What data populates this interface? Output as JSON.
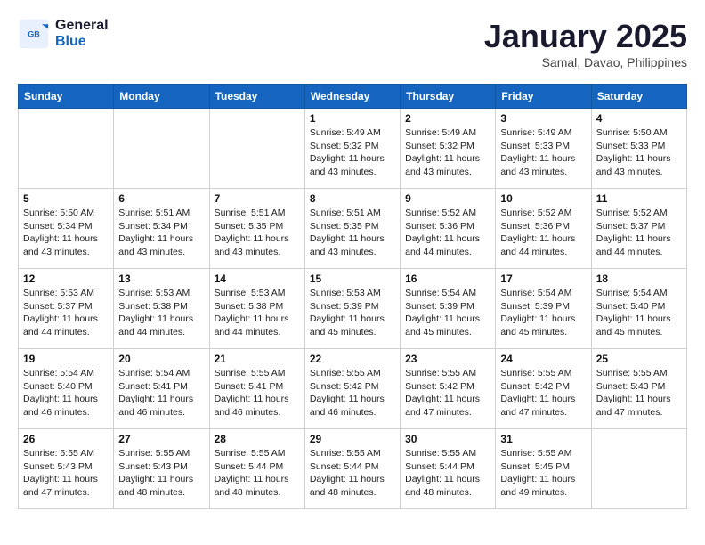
{
  "header": {
    "logo_line1": "General",
    "logo_line2": "Blue",
    "month": "January 2025",
    "location": "Samal, Davao, Philippines"
  },
  "weekdays": [
    "Sunday",
    "Monday",
    "Tuesday",
    "Wednesday",
    "Thursday",
    "Friday",
    "Saturday"
  ],
  "weeks": [
    [
      {
        "day": "",
        "sunrise": "",
        "sunset": "",
        "daylight": "",
        "empty": true
      },
      {
        "day": "",
        "sunrise": "",
        "sunset": "",
        "daylight": "",
        "empty": true
      },
      {
        "day": "",
        "sunrise": "",
        "sunset": "",
        "daylight": "",
        "empty": true
      },
      {
        "day": "1",
        "sunrise": "Sunrise: 5:49 AM",
        "sunset": "Sunset: 5:32 PM",
        "daylight": "Daylight: 11 hours and 43 minutes."
      },
      {
        "day": "2",
        "sunrise": "Sunrise: 5:49 AM",
        "sunset": "Sunset: 5:32 PM",
        "daylight": "Daylight: 11 hours and 43 minutes."
      },
      {
        "day": "3",
        "sunrise": "Sunrise: 5:49 AM",
        "sunset": "Sunset: 5:33 PM",
        "daylight": "Daylight: 11 hours and 43 minutes."
      },
      {
        "day": "4",
        "sunrise": "Sunrise: 5:50 AM",
        "sunset": "Sunset: 5:33 PM",
        "daylight": "Daylight: 11 hours and 43 minutes."
      }
    ],
    [
      {
        "day": "5",
        "sunrise": "Sunrise: 5:50 AM",
        "sunset": "Sunset: 5:34 PM",
        "daylight": "Daylight: 11 hours and 43 minutes."
      },
      {
        "day": "6",
        "sunrise": "Sunrise: 5:51 AM",
        "sunset": "Sunset: 5:34 PM",
        "daylight": "Daylight: 11 hours and 43 minutes."
      },
      {
        "day": "7",
        "sunrise": "Sunrise: 5:51 AM",
        "sunset": "Sunset: 5:35 PM",
        "daylight": "Daylight: 11 hours and 43 minutes."
      },
      {
        "day": "8",
        "sunrise": "Sunrise: 5:51 AM",
        "sunset": "Sunset: 5:35 PM",
        "daylight": "Daylight: 11 hours and 43 minutes."
      },
      {
        "day": "9",
        "sunrise": "Sunrise: 5:52 AM",
        "sunset": "Sunset: 5:36 PM",
        "daylight": "Daylight: 11 hours and 44 minutes."
      },
      {
        "day": "10",
        "sunrise": "Sunrise: 5:52 AM",
        "sunset": "Sunset: 5:36 PM",
        "daylight": "Daylight: 11 hours and 44 minutes."
      },
      {
        "day": "11",
        "sunrise": "Sunrise: 5:52 AM",
        "sunset": "Sunset: 5:37 PM",
        "daylight": "Daylight: 11 hours and 44 minutes."
      }
    ],
    [
      {
        "day": "12",
        "sunrise": "Sunrise: 5:53 AM",
        "sunset": "Sunset: 5:37 PM",
        "daylight": "Daylight: 11 hours and 44 minutes."
      },
      {
        "day": "13",
        "sunrise": "Sunrise: 5:53 AM",
        "sunset": "Sunset: 5:38 PM",
        "daylight": "Daylight: 11 hours and 44 minutes."
      },
      {
        "day": "14",
        "sunrise": "Sunrise: 5:53 AM",
        "sunset": "Sunset: 5:38 PM",
        "daylight": "Daylight: 11 hours and 44 minutes."
      },
      {
        "day": "15",
        "sunrise": "Sunrise: 5:53 AM",
        "sunset": "Sunset: 5:39 PM",
        "daylight": "Daylight: 11 hours and 45 minutes."
      },
      {
        "day": "16",
        "sunrise": "Sunrise: 5:54 AM",
        "sunset": "Sunset: 5:39 PM",
        "daylight": "Daylight: 11 hours and 45 minutes."
      },
      {
        "day": "17",
        "sunrise": "Sunrise: 5:54 AM",
        "sunset": "Sunset: 5:39 PM",
        "daylight": "Daylight: 11 hours and 45 minutes."
      },
      {
        "day": "18",
        "sunrise": "Sunrise: 5:54 AM",
        "sunset": "Sunset: 5:40 PM",
        "daylight": "Daylight: 11 hours and 45 minutes."
      }
    ],
    [
      {
        "day": "19",
        "sunrise": "Sunrise: 5:54 AM",
        "sunset": "Sunset: 5:40 PM",
        "daylight": "Daylight: 11 hours and 46 minutes."
      },
      {
        "day": "20",
        "sunrise": "Sunrise: 5:54 AM",
        "sunset": "Sunset: 5:41 PM",
        "daylight": "Daylight: 11 hours and 46 minutes."
      },
      {
        "day": "21",
        "sunrise": "Sunrise: 5:55 AM",
        "sunset": "Sunset: 5:41 PM",
        "daylight": "Daylight: 11 hours and 46 minutes."
      },
      {
        "day": "22",
        "sunrise": "Sunrise: 5:55 AM",
        "sunset": "Sunset: 5:42 PM",
        "daylight": "Daylight: 11 hours and 46 minutes."
      },
      {
        "day": "23",
        "sunrise": "Sunrise: 5:55 AM",
        "sunset": "Sunset: 5:42 PM",
        "daylight": "Daylight: 11 hours and 47 minutes."
      },
      {
        "day": "24",
        "sunrise": "Sunrise: 5:55 AM",
        "sunset": "Sunset: 5:42 PM",
        "daylight": "Daylight: 11 hours and 47 minutes."
      },
      {
        "day": "25",
        "sunrise": "Sunrise: 5:55 AM",
        "sunset": "Sunset: 5:43 PM",
        "daylight": "Daylight: 11 hours and 47 minutes."
      }
    ],
    [
      {
        "day": "26",
        "sunrise": "Sunrise: 5:55 AM",
        "sunset": "Sunset: 5:43 PM",
        "daylight": "Daylight: 11 hours and 47 minutes."
      },
      {
        "day": "27",
        "sunrise": "Sunrise: 5:55 AM",
        "sunset": "Sunset: 5:43 PM",
        "daylight": "Daylight: 11 hours and 48 minutes."
      },
      {
        "day": "28",
        "sunrise": "Sunrise: 5:55 AM",
        "sunset": "Sunset: 5:44 PM",
        "daylight": "Daylight: 11 hours and 48 minutes."
      },
      {
        "day": "29",
        "sunrise": "Sunrise: 5:55 AM",
        "sunset": "Sunset: 5:44 PM",
        "daylight": "Daylight: 11 hours and 48 minutes."
      },
      {
        "day": "30",
        "sunrise": "Sunrise: 5:55 AM",
        "sunset": "Sunset: 5:44 PM",
        "daylight": "Daylight: 11 hours and 48 minutes."
      },
      {
        "day": "31",
        "sunrise": "Sunrise: 5:55 AM",
        "sunset": "Sunset: 5:45 PM",
        "daylight": "Daylight: 11 hours and 49 minutes."
      },
      {
        "day": "",
        "sunrise": "",
        "sunset": "",
        "daylight": "",
        "empty": true
      }
    ]
  ]
}
